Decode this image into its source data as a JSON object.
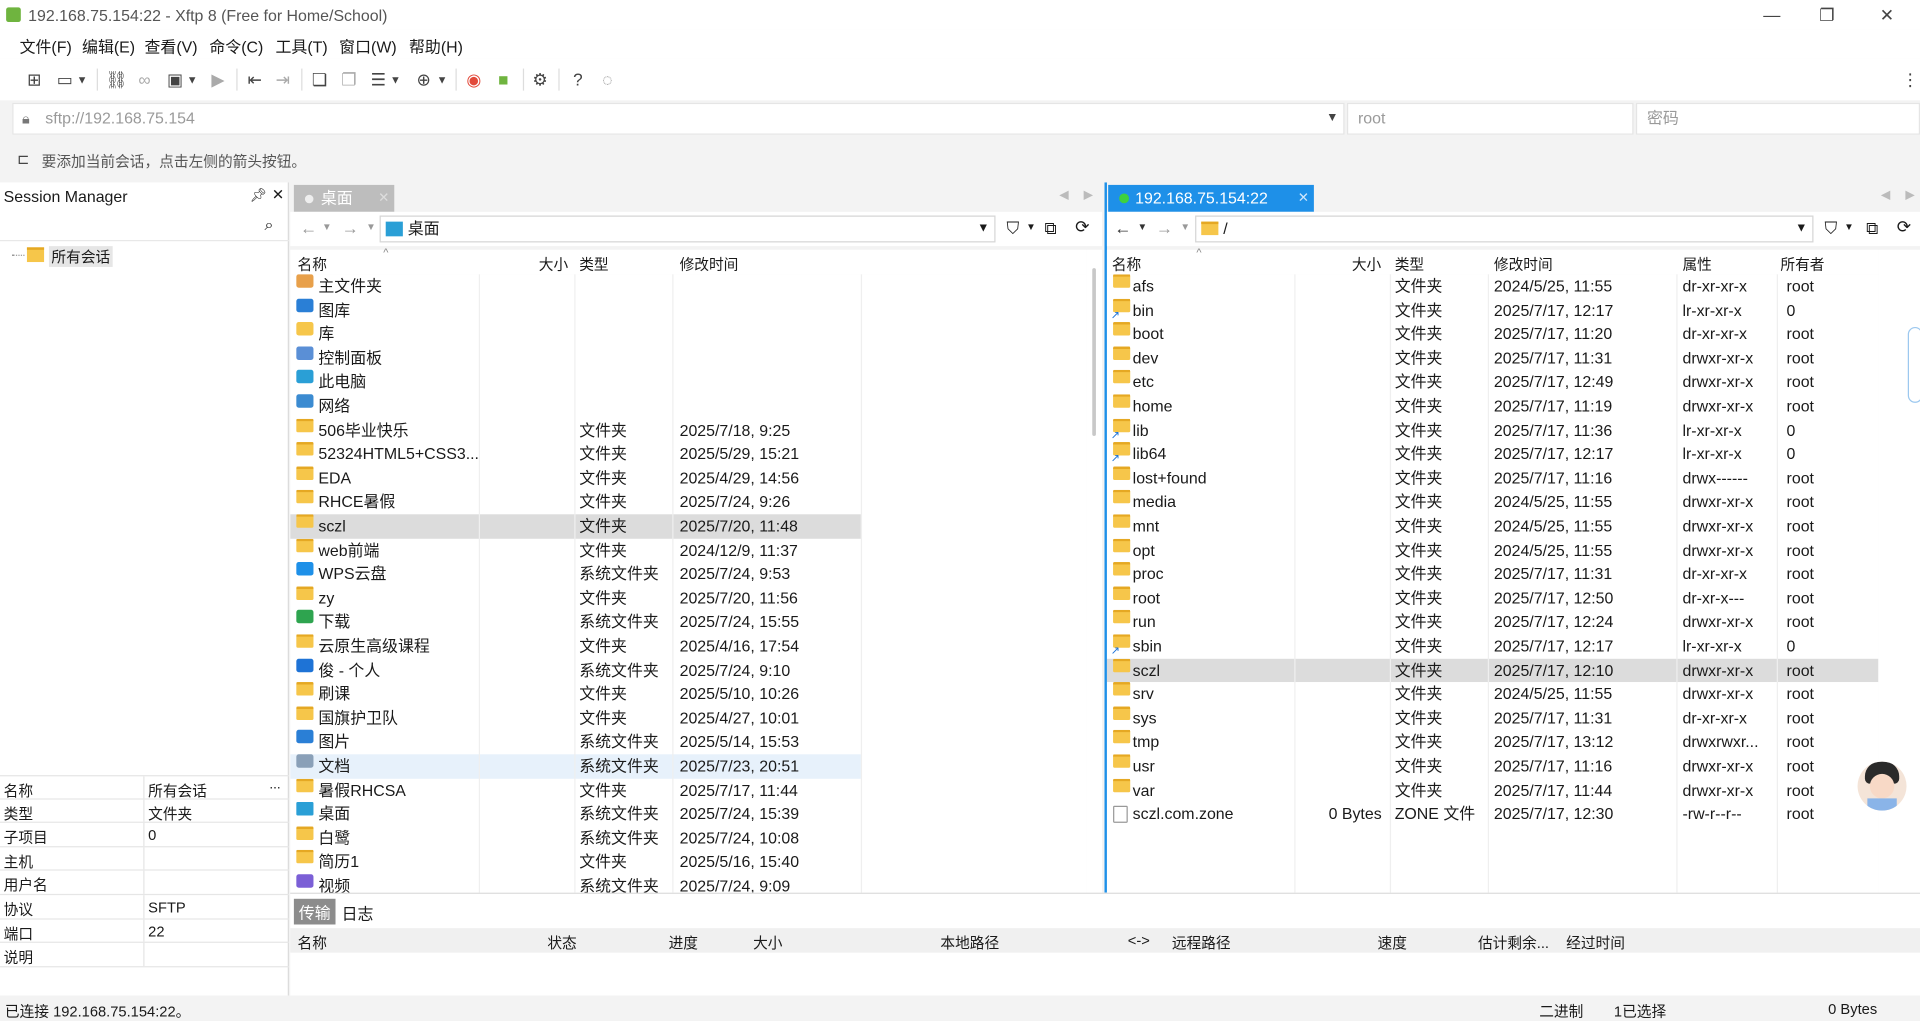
{
  "window": {
    "title": "192.168.75.154:22 - Xftp 8 (Free for Home/School)"
  },
  "menu": [
    "文件(F)",
    "编辑(E)",
    "查看(V)",
    "命令(C)",
    "工具(T)",
    "窗口(W)",
    "帮助(H)"
  ],
  "address": {
    "url": "sftp://192.168.75.154",
    "user": "root",
    "password_placeholder": "密码"
  },
  "hint": "要添加当前会话，点击左侧的箭头按钮。",
  "session": {
    "title": "Session Manager",
    "tree_root": "所有会话",
    "props": [
      [
        "名称",
        "所有会话"
      ],
      [
        "类型",
        "文件夹"
      ],
      [
        "子项目",
        "0"
      ],
      [
        "主机",
        ""
      ],
      [
        "用户名",
        ""
      ],
      [
        "协议",
        "SFTP"
      ],
      [
        "端口",
        "22"
      ],
      [
        "说明",
        ""
      ]
    ]
  },
  "local": {
    "tab": "桌面",
    "path": "桌面",
    "columns": [
      "名称",
      "大小",
      "类型",
      "修改时间"
    ],
    "files": [
      [
        "主文件夹",
        "",
        "",
        ""
      ],
      [
        "图库",
        "",
        "",
        ""
      ],
      [
        "库",
        "",
        "",
        ""
      ],
      [
        "控制面板",
        "",
        "",
        ""
      ],
      [
        "此电脑",
        "",
        "",
        ""
      ],
      [
        "网络",
        "",
        "",
        ""
      ],
      [
        "506毕业快乐",
        "",
        "文件夹",
        "2025/7/18, 9:25"
      ],
      [
        "52324HTML5+CSS3...",
        "",
        "文件夹",
        "2025/5/29, 15:21"
      ],
      [
        "EDA",
        "",
        "文件夹",
        "2025/4/29, 14:56"
      ],
      [
        "RHCE暑假",
        "",
        "文件夹",
        "2025/7/24, 9:26"
      ],
      [
        "sczl",
        "",
        "文件夹",
        "2025/7/20, 11:48"
      ],
      [
        "web前端",
        "",
        "文件夹",
        "2024/12/9, 11:37"
      ],
      [
        "WPS云盘",
        "",
        "系统文件夹",
        "2025/7/24, 9:53"
      ],
      [
        "zy",
        "",
        "文件夹",
        "2025/7/20, 11:56"
      ],
      [
        "下载",
        "",
        "系统文件夹",
        "2025/7/24, 15:55"
      ],
      [
        "云原生高级课程",
        "",
        "文件夹",
        "2025/4/16, 17:54"
      ],
      [
        "俊 - 个人",
        "",
        "系统文件夹",
        "2025/7/24, 9:10"
      ],
      [
        "刷课",
        "",
        "文件夹",
        "2025/5/10, 10:26"
      ],
      [
        "国旗护卫队",
        "",
        "文件夹",
        "2025/4/27, 10:01"
      ],
      [
        "图片",
        "",
        "系统文件夹",
        "2025/5/14, 15:53"
      ],
      [
        "文档",
        "",
        "系统文件夹",
        "2025/7/23, 20:51"
      ],
      [
        "暑假RHCSA",
        "",
        "文件夹",
        "2025/7/17, 11:44"
      ],
      [
        "桌面",
        "",
        "系统文件夹",
        "2025/7/24, 15:39"
      ],
      [
        "白鹭",
        "",
        "系统文件夹",
        "2025/7/24, 10:08"
      ],
      [
        "简历1",
        "",
        "文件夹",
        "2025/5/16, 15:40"
      ],
      [
        "视频",
        "",
        "系统文件夹",
        "2025/7/24, 9:09"
      ]
    ]
  },
  "remote": {
    "tab": "192.168.75.154:22",
    "path": "/",
    "columns": [
      "名称",
      "大小",
      "类型",
      "修改时间",
      "属性",
      "所有者"
    ],
    "files": [
      [
        "afs",
        "",
        "文件夹",
        "2024/5/25, 11:55",
        "dr-xr-xr-x",
        "root"
      ],
      [
        "bin",
        "",
        "文件夹",
        "2025/7/17, 12:17",
        "lr-xr-xr-x",
        "0"
      ],
      [
        "boot",
        "",
        "文件夹",
        "2025/7/17, 11:20",
        "dr-xr-xr-x",
        "root"
      ],
      [
        "dev",
        "",
        "文件夹",
        "2025/7/17, 11:31",
        "drwxr-xr-x",
        "root"
      ],
      [
        "etc",
        "",
        "文件夹",
        "2025/7/17, 12:49",
        "drwxr-xr-x",
        "root"
      ],
      [
        "home",
        "",
        "文件夹",
        "2025/7/17, 11:19",
        "drwxr-xr-x",
        "root"
      ],
      [
        "lib",
        "",
        "文件夹",
        "2025/7/17, 11:36",
        "lr-xr-xr-x",
        "0"
      ],
      [
        "lib64",
        "",
        "文件夹",
        "2025/7/17, 12:17",
        "lr-xr-xr-x",
        "0"
      ],
      [
        "lost+found",
        "",
        "文件夹",
        "2025/7/17, 11:16",
        "drwx------",
        "root"
      ],
      [
        "media",
        "",
        "文件夹",
        "2024/5/25, 11:55",
        "drwxr-xr-x",
        "root"
      ],
      [
        "mnt",
        "",
        "文件夹",
        "2024/5/25, 11:55",
        "drwxr-xr-x",
        "root"
      ],
      [
        "opt",
        "",
        "文件夹",
        "2024/5/25, 11:55",
        "drwxr-xr-x",
        "root"
      ],
      [
        "proc",
        "",
        "文件夹",
        "2025/7/17, 11:31",
        "dr-xr-xr-x",
        "root"
      ],
      [
        "root",
        "",
        "文件夹",
        "2025/7/17, 12:50",
        "dr-xr-x---",
        "root"
      ],
      [
        "run",
        "",
        "文件夹",
        "2025/7/17, 12:24",
        "drwxr-xr-x",
        "root"
      ],
      [
        "sbin",
        "",
        "文件夹",
        "2025/7/17, 12:17",
        "lr-xr-xr-x",
        "0"
      ],
      [
        "sczl",
        "",
        "文件夹",
        "2025/7/17, 12:10",
        "drwxr-xr-x",
        "root"
      ],
      [
        "srv",
        "",
        "文件夹",
        "2024/5/25, 11:55",
        "drwxr-xr-x",
        "root"
      ],
      [
        "sys",
        "",
        "文件夹",
        "2025/7/17, 11:31",
        "dr-xr-xr-x",
        "root"
      ],
      [
        "tmp",
        "",
        "文件夹",
        "2025/7/17, 13:12",
        "drwxrwxr...",
        "root"
      ],
      [
        "usr",
        "",
        "文件夹",
        "2025/7/17, 11:16",
        "drwxr-xr-x",
        "root"
      ],
      [
        "var",
        "",
        "文件夹",
        "2025/7/17, 11:44",
        "drwxr-xr-x",
        "root"
      ],
      [
        "sczl.com.zone",
        "0 Bytes",
        "ZONE 文件",
        "2025/7/17, 12:30",
        "-rw-r--r--",
        "root"
      ]
    ]
  },
  "transfer": {
    "tabs": [
      "传输",
      "日志"
    ],
    "columns": [
      "名称",
      "状态",
      "进度",
      "大小",
      "本地路径",
      "<->",
      "远程路径",
      "速度",
      "估计剩余...",
      "经过时间"
    ]
  },
  "status": {
    "left": "已连接 192.168.75.154:22。",
    "mode": "二进制",
    "selection": "1已选择",
    "size": "0 Bytes"
  },
  "colors": {
    "accent": "#1e90e8",
    "folder": "#f6c64a",
    "selected": "#dcdcdc"
  }
}
